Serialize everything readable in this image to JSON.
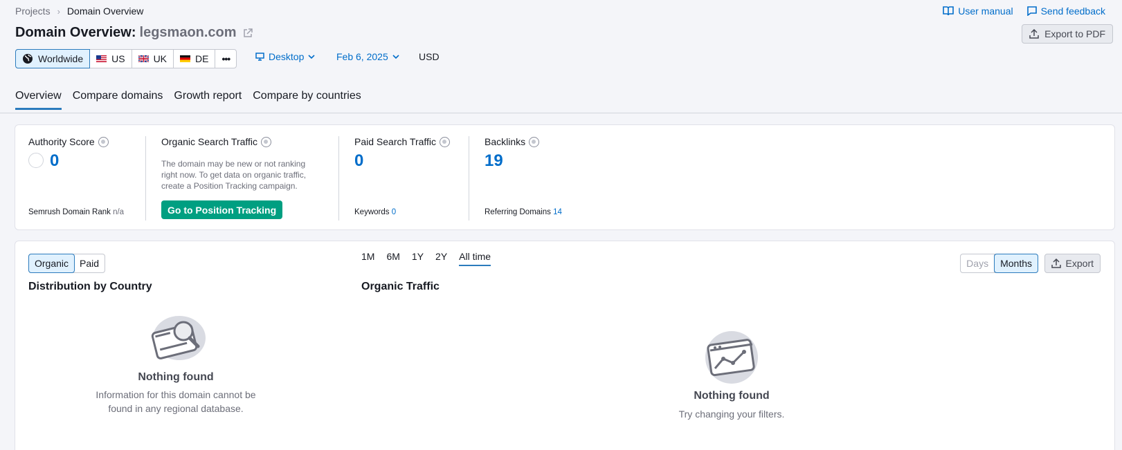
{
  "breadcrumb": {
    "parent": "Projects",
    "current": "Domain Overview"
  },
  "top_links": {
    "manual": "User manual",
    "feedback": "Send feedback"
  },
  "title": {
    "prefix": "Domain Overview:",
    "domain": "legsmaon.com"
  },
  "export_pdf": "Export to PDF",
  "regions": [
    {
      "label": "Worldwide",
      "icon": "globe-icon",
      "active": true
    },
    {
      "label": "US",
      "icon": "flag-us-icon"
    },
    {
      "label": "UK",
      "icon": "flag-uk-icon"
    },
    {
      "label": "DE",
      "icon": "flag-de-icon"
    },
    {
      "label": "•••",
      "icon": "more-icon"
    }
  ],
  "filters": {
    "device": "Desktop",
    "date": "Feb 6, 2025",
    "currency": "USD"
  },
  "tabs": [
    {
      "label": "Overview",
      "active": true
    },
    {
      "label": "Compare domains"
    },
    {
      "label": "Growth report"
    },
    {
      "label": "Compare by countries"
    }
  ],
  "metrics": {
    "authority": {
      "label": "Authority Score",
      "value": "0",
      "sub_label": "Semrush Domain Rank",
      "sub_value": "n/a"
    },
    "organic": {
      "label": "Organic Search Traffic",
      "desc": "The domain may be new or not ranking right now. To get data on organic traffic, create a Position Tracking campaign.",
      "button": "Go to Position Tracking"
    },
    "paid": {
      "label": "Paid Search Traffic",
      "value": "0",
      "sub_label": "Keywords",
      "sub_value": "0"
    },
    "backlinks": {
      "label": "Backlinks",
      "value": "19",
      "sub_label": "Referring Domains",
      "sub_value": "14"
    }
  },
  "lower": {
    "type_toggle": [
      "Organic",
      "Paid"
    ],
    "periods": [
      "1M",
      "6M",
      "1Y",
      "2Y",
      "All time"
    ],
    "granularity": [
      "Days",
      "Months"
    ],
    "export": "Export",
    "distribution": {
      "title": "Distribution by Country",
      "empty_title": "Nothing found",
      "empty_desc": "Information for this domain cannot be found in any regional database."
    },
    "traffic": {
      "title": "Organic Traffic",
      "empty_title": "Nothing found",
      "empty_desc": "Try changing your filters."
    }
  },
  "colors": {
    "accent": "#006dca",
    "cta": "#009f81",
    "active_bg": "#e0f1fe"
  }
}
